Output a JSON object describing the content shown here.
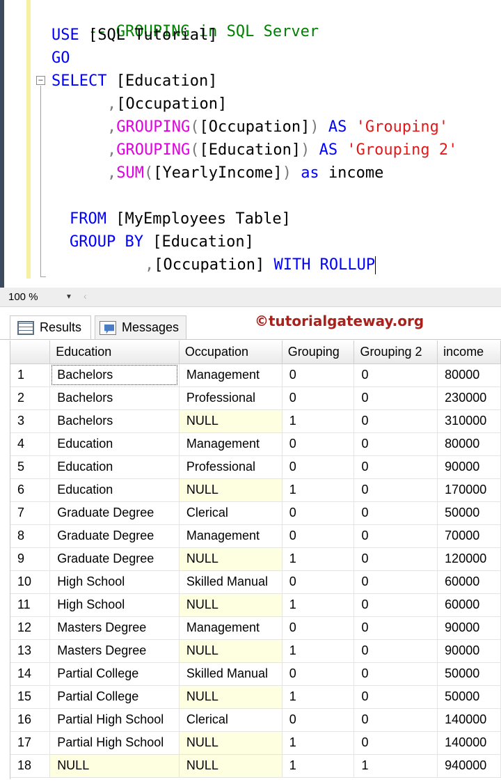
{
  "editor": {
    "comment": "-- GROUPING in SQL Server",
    "use_kw": "USE",
    "database": "[SQL Tutorial]",
    "go_kw": "GO",
    "select_kw": "SELECT",
    "col_education": "[Education]",
    "comma": ",",
    "col_occupation": "[Occupation]",
    "grouping_fn": "GROUPING",
    "paren_open": "(",
    "paren_close": ")",
    "as_upper": "AS",
    "as_lower": "as",
    "alias_grouping": "'Grouping'",
    "alias_grouping2": "'Grouping 2'",
    "sum_fn": "SUM",
    "col_yearly_income": "[YearlyIncome]",
    "alias_income": "income",
    "from_kw": "FROM",
    "table_name": "[MyEmployees Table]",
    "group_by_kw": "GROUP BY",
    "with_rollup_kw": "WITH ROLLUP"
  },
  "zoom": {
    "value": "100 %"
  },
  "watermark": "©tutorialgateway.org",
  "tabs": {
    "results_label": "Results",
    "messages_label": "Messages"
  },
  "results": {
    "columns": [
      "",
      "Education",
      "Occupation",
      "Grouping",
      "Grouping 2",
      "income"
    ],
    "rows": [
      [
        "1",
        "Bachelors",
        "Management",
        "0",
        "0",
        "80000"
      ],
      [
        "2",
        "Bachelors",
        "Professional",
        "0",
        "0",
        "230000"
      ],
      [
        "3",
        "Bachelors",
        "NULL",
        "1",
        "0",
        "310000"
      ],
      [
        "4",
        "Education",
        "Management",
        "0",
        "0",
        "80000"
      ],
      [
        "5",
        "Education",
        "Professional",
        "0",
        "0",
        "90000"
      ],
      [
        "6",
        "Education",
        "NULL",
        "1",
        "0",
        "170000"
      ],
      [
        "7",
        "Graduate Degree",
        "Clerical",
        "0",
        "0",
        "50000"
      ],
      [
        "8",
        "Graduate Degree",
        "Management",
        "0",
        "0",
        "70000"
      ],
      [
        "9",
        "Graduate Degree",
        "NULL",
        "1",
        "0",
        "120000"
      ],
      [
        "10",
        "High School",
        "Skilled Manual",
        "0",
        "0",
        "60000"
      ],
      [
        "11",
        "High School",
        "NULL",
        "1",
        "0",
        "60000"
      ],
      [
        "12",
        "Masters Degree",
        "Management",
        "0",
        "0",
        "90000"
      ],
      [
        "13",
        "Masters Degree",
        "NULL",
        "1",
        "0",
        "90000"
      ],
      [
        "14",
        "Partial College",
        "Skilled Manual",
        "0",
        "0",
        "50000"
      ],
      [
        "15",
        "Partial College",
        "NULL",
        "1",
        "0",
        "50000"
      ],
      [
        "16",
        "Partial High School",
        "Clerical",
        "0",
        "0",
        "140000"
      ],
      [
        "17",
        "Partial High School",
        "NULL",
        "1",
        "0",
        "140000"
      ],
      [
        "18",
        "NULL",
        "NULL",
        "1",
        "1",
        "940000"
      ]
    ]
  },
  "colors": {
    "keyword": "#0000ff",
    "function": "#e100e1",
    "string": "#e01a1a",
    "comment": "#008000",
    "null_cell_bg": "#fefee0",
    "watermark": "#a8211b"
  }
}
